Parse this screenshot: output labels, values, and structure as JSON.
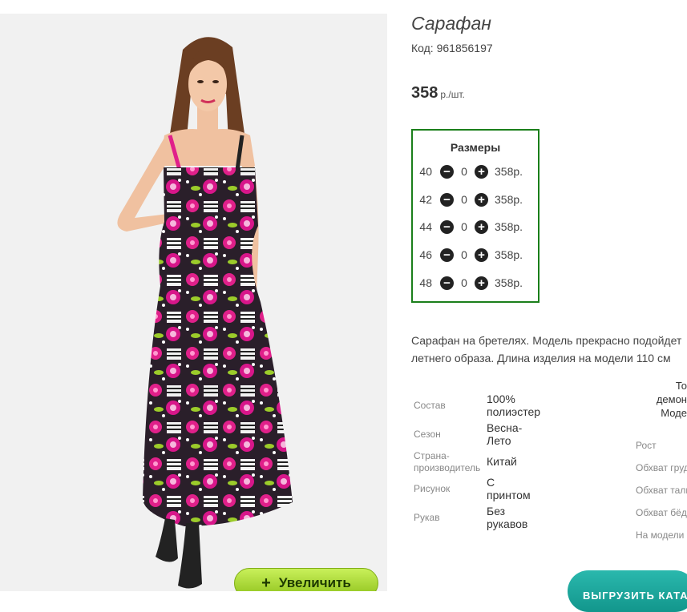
{
  "product": {
    "title": "Сарафан",
    "code": "Код: 961856197",
    "price_value": "358",
    "price_unit": "р./шт."
  },
  "sizes": {
    "header": "Размеры",
    "rows": [
      {
        "size": "40",
        "qty": "0",
        "price": "358р."
      },
      {
        "size": "42",
        "qty": "0",
        "price": "358р."
      },
      {
        "size": "44",
        "qty": "0",
        "price": "358р."
      },
      {
        "size": "46",
        "qty": "0",
        "price": "358р."
      },
      {
        "size": "48",
        "qty": "0",
        "price": "358р."
      }
    ]
  },
  "description": {
    "line1": "Сарафан на бретелях. Модель прекрасно подойдет",
    "line2": "летнего образа. Длина изделия на модели 110 см"
  },
  "attributes": [
    {
      "label": "Состав",
      "value_line1": "100%",
      "value_line2": "полиэстер"
    },
    {
      "label": "Сезон",
      "value_line1": "Весна-",
      "value_line2": "Лето"
    },
    {
      "label_line1": "Страна-",
      "label_line2": "производитель",
      "value_line1": "Китай"
    },
    {
      "label": "Рисунок",
      "value_line1": "С",
      "value_line2": "принтом"
    },
    {
      "label": "Рукав",
      "value_line1": "Без",
      "value_line2": "рукавов"
    }
  ],
  "model_table": {
    "header_line1": "То",
    "header_line2": "демон",
    "header_line3": "Моде",
    "labels": [
      "Рост",
      "Обхват груд",
      "Обхват тали",
      "Обхват бёд",
      "На модели"
    ]
  },
  "buttons": {
    "zoom_label": "Увеличить",
    "zoom_plus": "+",
    "export_label": "ВЫГРУЗИТЬ КАТА",
    "minus_glyph": "−",
    "plus_glyph": "+"
  },
  "colors": {
    "accent_green": "#1b7f1b",
    "zoom_button": "#a6d632",
    "export_button": "#1aa79c",
    "dress_pink": "#e0208a"
  }
}
